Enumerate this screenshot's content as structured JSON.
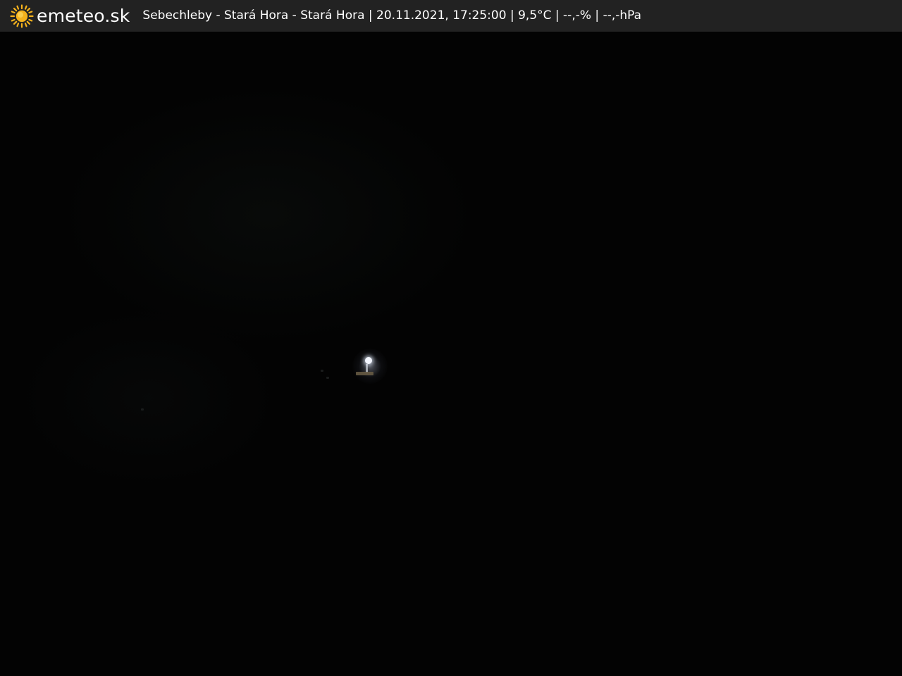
{
  "header": {
    "brand": "emeteo.sk",
    "location": "Sebechleby - Stará Hora - Stará Hora",
    "datetime": "20.11.2021, 17:25:00",
    "temperature": "9,5°C",
    "humidity": "--,-%",
    "pressure": "--,-hPa",
    "separator": " | ",
    "icon": "sun-icon",
    "bar_color": "#222222",
    "sun_color": "#f5b21c"
  },
  "scene": {
    "description_icon": "street-light-icon"
  }
}
